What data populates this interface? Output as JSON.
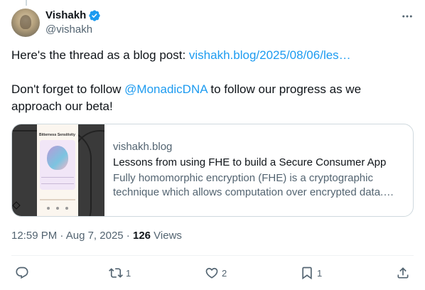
{
  "author": {
    "display_name": "Vishakh",
    "handle": "@vishakh",
    "verified": true
  },
  "body": {
    "line1_prefix": "Here's the thread as a blog post: ",
    "line1_link": "vishakh.blog/2025/08/06/les…",
    "line2_prefix": "Don't forget to follow ",
    "line2_mention": "@MonadicDNA",
    "line2_suffix": " to follow our progress as we approach our beta!"
  },
  "card": {
    "domain": "vishakh.blog",
    "title": "Lessons from using FHE to build a Secure Consumer App",
    "description": "Fully homomorphic encryption (FHE) is a cryptographic technique which allows computation over encrypted data.…",
    "thumbnail": {
      "screen_title": "Bitterness Sensitivity"
    }
  },
  "meta": {
    "time": "12:59 PM",
    "separator": " · ",
    "date": "Aug 7, 2025",
    "views_count": "126",
    "views_label": " Views"
  },
  "actions": {
    "reply_count": "",
    "repost_count": "1",
    "like_count": "2",
    "bookmark_count": "1"
  },
  "colors": {
    "accent": "#1d9bf0",
    "text": "#0f1419",
    "secondary": "#536471",
    "border": "#cfd9de"
  }
}
